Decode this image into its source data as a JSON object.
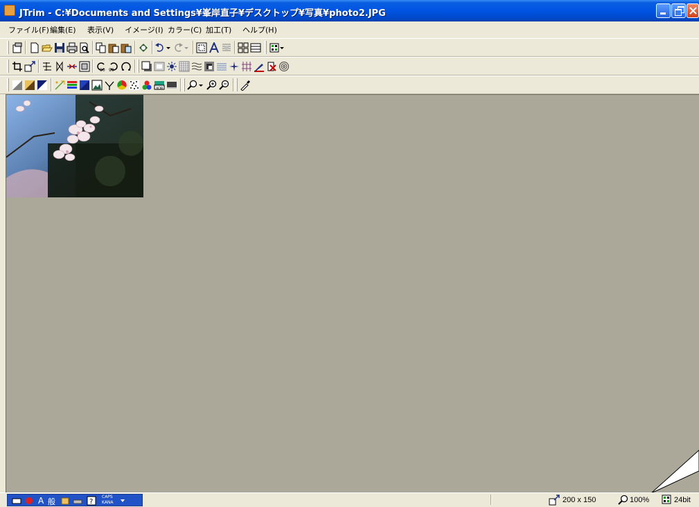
{
  "window": {
    "title": "JTrim - C:¥Documents and Settings¥峯岸直子¥デスクトップ¥写真¥photo2.JPG",
    "accent": "#0054e3",
    "close_color": "#d0401a"
  },
  "menu": [
    {
      "label": "ファイル(F)"
    },
    {
      "label": "編集(E)"
    },
    {
      "label": "表示(V)"
    },
    {
      "label": "イメージ(I)"
    },
    {
      "label": "カラー(C)"
    },
    {
      "label": "加工(T)"
    },
    {
      "label": "ヘルプ(H)"
    }
  ],
  "toolbars": {
    "row1": [
      "paste-new-icon",
      "new-icon",
      "open-icon",
      "save-icon",
      "print-icon",
      "print-preview-icon",
      "copy-icon",
      "paste-icon",
      "paste-special-icon",
      "capture-icon",
      "undo-icon",
      "redo-icon",
      "fit-window-icon",
      "text-icon",
      "align-icon",
      "grid-icon",
      "thumbnail-icon",
      "color-palette-icon"
    ],
    "row2": [
      "crop-icon",
      "resize-icon",
      "flip-vertical-icon",
      "flip-horizontal-icon",
      "trim-center-icon",
      "frame-icon",
      "rotate-left-icon",
      "rotate-right-icon",
      "rotate-free-icon",
      "shadow-icon",
      "border-icon",
      "brightness-icon",
      "mosaic-icon",
      "wave-icon",
      "blur-icon",
      "stripes-icon",
      "sharpen-icon",
      "weave-icon",
      "pen-icon",
      "eraser-icon",
      "swirl-icon"
    ],
    "row3": [
      "grayscale-icon",
      "sepia-icon",
      "negative-icon",
      "sparkle-icon",
      "color-bars-icon",
      "color-balance-icon",
      "image-icon",
      "gamma-icon",
      "hue-icon",
      "noise-icon",
      "rgb-icon",
      "xor-icon",
      "contrast-icon",
      "zoom-icon",
      "zoom-in-icon",
      "zoom-out-icon",
      "eyedropper-icon"
    ]
  },
  "status": {
    "image_size": "200 x 150",
    "zoom": "100%",
    "color_depth": "24bit",
    "ime_caps": "CAPS",
    "ime_kana": "KANA"
  }
}
